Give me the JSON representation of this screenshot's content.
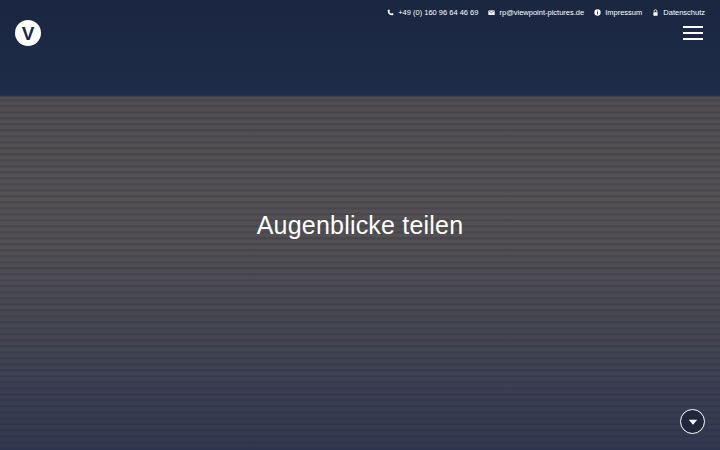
{
  "logo": {
    "text": "V"
  },
  "contacts": [
    {
      "label": "+49 (0) 160 96 64 46 69"
    },
    {
      "label": "rp@viewpoint-pictures.de"
    },
    {
      "label": "Impressum"
    },
    {
      "label": "Datenschutz"
    }
  ],
  "hero": {
    "headline": "Augenblicke teilen"
  }
}
